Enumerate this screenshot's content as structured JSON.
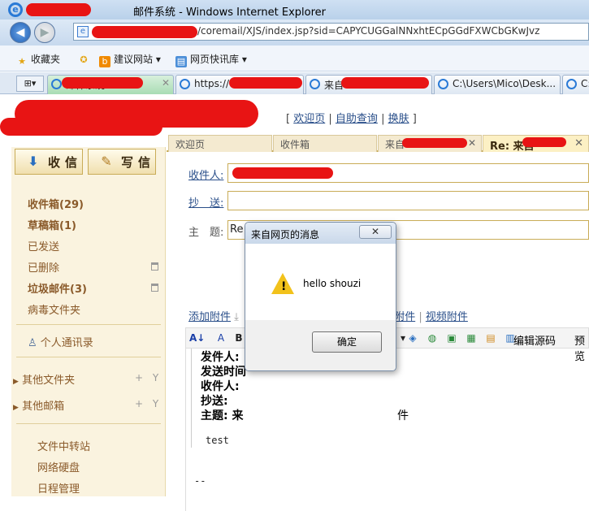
{
  "browser": {
    "title": "邮件系统 - Windows Internet Explorer",
    "url": "/coremail/XJS/index.jsp?sid=CAPYCUGGalNNxhtECpGGdFXWCbGKwJvz",
    "favorites_label": "收藏夹",
    "suggested_sites": "建议网站 ▾",
    "web_slice": "网页快讯库 ▾",
    "tabs": [
      {
        "label": "邮件系统",
        "close": "✕"
      },
      {
        "label": "https://",
        "close": "✕"
      },
      {
        "label": "来自",
        "close": ""
      },
      {
        "label": "C:\\Users\\Mico\\Desk...",
        "close": ""
      },
      {
        "label": "C:",
        "close": ""
      }
    ]
  },
  "header_links": {
    "open": "[",
    "welcome": "欢迎页",
    "self_query": "自助查询",
    "skin": "换肤",
    "close": "]",
    "sep": "|"
  },
  "mail_tabs": [
    {
      "label": "欢迎页"
    },
    {
      "label": "收件箱"
    },
    {
      "label": "来自",
      "close": "✕"
    },
    {
      "label": "Re: 来自",
      "close": "✕"
    }
  ],
  "sidebar": {
    "receive": "收信",
    "compose": "写信",
    "folders": [
      {
        "label": "收件箱(29)",
        "bold": true
      },
      {
        "label": "草稿箱(1)",
        "bold": true
      },
      {
        "label": "已发送"
      },
      {
        "label": "已删除"
      },
      {
        "label": "垃圾邮件(3)",
        "bold": true
      },
      {
        "label": "病毒文件夹"
      }
    ],
    "contacts": "个人通讯录",
    "other_folders": "其他文件夹",
    "other_mailboxes": "其他邮箱",
    "plus_y": "+ Y",
    "tools": [
      "文件中转站",
      "网络硬盘",
      "日程管理"
    ]
  },
  "compose": {
    "to_label": "收件人:",
    "cc_label": "抄　送:",
    "subject_label": "主　题:",
    "subject_value": "Re:",
    "attach": "添加附件",
    "audio_attach": "音附件",
    "video_attach": "视频附件",
    "edit_source": "编辑源码",
    "preview": "预览",
    "quote_lines": [
      "发件人:",
      "发送时间",
      "收件人:",
      "抄送:",
      "主题: 来"
    ],
    "quote_tail": "件",
    "body": "test",
    "signature": "--"
  },
  "dialog": {
    "title": "来自网页的消息",
    "close": "✕",
    "message": "hello shouzi",
    "ok": "确定"
  }
}
